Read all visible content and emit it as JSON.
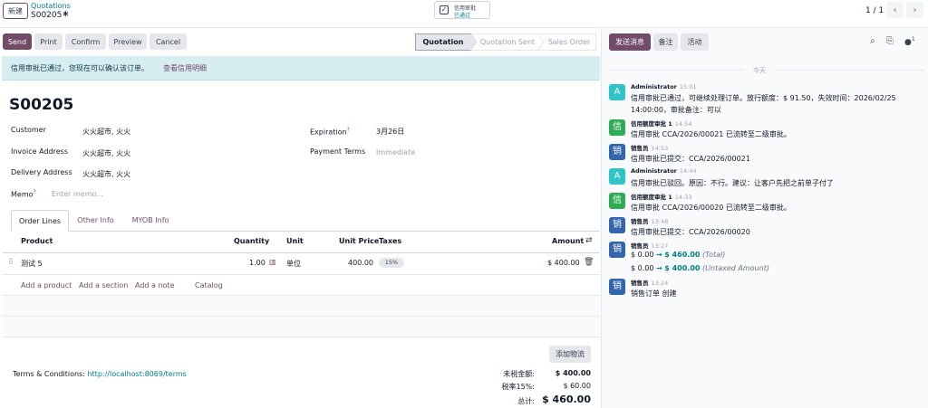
{
  "topbar": {
    "new_label": "新建",
    "breadcrumb_parent": "Quotations",
    "breadcrumb_current": "S00205",
    "credit_label": "信用审批",
    "credit_status": "已通过",
    "pager": "1 / 1"
  },
  "actions": {
    "send": "Send",
    "print": "Print",
    "confirm": "Confirm",
    "preview": "Preview",
    "cancel": "Cancel"
  },
  "stages": [
    "Quotation",
    "Quotation Sent",
    "Sales Order"
  ],
  "alert": {
    "text": "信用审批已通过，您现在可以确认该订单。",
    "link": "查看信用明细"
  },
  "form": {
    "name": "S00205",
    "customer_label": "Customer",
    "customer": "火火超市, 火火",
    "invoice_label": "Invoice Address",
    "invoice": "火火超市, 火火",
    "delivery_label": "Delivery Address",
    "delivery": "火火超市, 火火",
    "memo_label": "Memo",
    "memo_placeholder": "Enter memo...",
    "expiration_label": "Expiration",
    "expiration": "3月26日",
    "payment_label": "Payment Terms",
    "payment_placeholder": "Immediate",
    "help_mark": "?"
  },
  "tabs": [
    "Order Lines",
    "Other Info",
    "MYOB Info"
  ],
  "table": {
    "headers": {
      "product": "Product",
      "quantity": "Quantity",
      "unit": "Unit",
      "price": "Unit Price",
      "taxes": "Taxes",
      "amount": "Amount"
    },
    "rows": [
      {
        "product": "测试 5",
        "quantity": "1.00",
        "unit": "单位",
        "price": "400.00",
        "tax": "15%",
        "amount": "$ 400.00"
      }
    ],
    "add_product": "Add a product",
    "add_section": "Add a section",
    "add_note": "Add a note",
    "catalog": "Catalog"
  },
  "footer": {
    "add_logistics": "添加物流",
    "terms_label": "Terms & Conditions:",
    "terms_link": "http://localhost:8069/terms",
    "untaxed_label": "未税金额:",
    "untaxed": "$ 400.00",
    "tax_label": "税率15%:",
    "tax": "$ 60.00",
    "total_label": "总计:",
    "total": "$ 460.00"
  },
  "chatter": {
    "send_message": "发送消息",
    "log_note": "备注",
    "activity": "活动",
    "followers_count": "1",
    "today": "今天",
    "messages": [
      {
        "avatar": "A",
        "author": "Administrator",
        "time": "15:01",
        "line1": "信用审批已通过，可继续处理订单。放行额度：$ 91.50，失效时间：2026/02/25",
        "line2": "14:00:00，审批备注：可以"
      },
      {
        "avatar": "信",
        "author": "信用额度审批 1",
        "time": "14:54",
        "line1": "信用审批 CCA/2026/00021 已流转至二级审批。"
      },
      {
        "avatar": "销",
        "author": "销售员",
        "time": "14:53",
        "line1": "信用审批已提交：CCA/2026/00021"
      },
      {
        "avatar": "A",
        "author": "Administrator",
        "time": "14:44",
        "line1": "信用审批已驳回。原因：不行。建议：让客户先把之前单子付了"
      },
      {
        "avatar": "信",
        "author": "信用额度审批 1",
        "time": "14:33",
        "line1": "信用审批 CCA/2026/00020 已流转至二级审批。"
      },
      {
        "avatar": "销",
        "author": "销售员",
        "time": "13:48",
        "line1": "信用审批已提交：CCA/2026/00020"
      },
      {
        "avatar": "销",
        "author": "销售员",
        "time": "13:27",
        "tracking": [
          {
            "old": "$ 0.00",
            "new": "$ 460.00",
            "field": "(Total)"
          },
          {
            "old": "$ 0.00",
            "new": "$ 400.00",
            "field": "(Untaxed Amount)"
          }
        ]
      },
      {
        "avatar": "销",
        "author": "销售员",
        "time": "13:24",
        "line1": "销售订单 创建"
      }
    ],
    "arrow": "→"
  },
  "colors": {
    "primary": "#714b67",
    "teal": "#017e84",
    "alert_bg": "#d6eef2",
    "avatar_admin": "#2ec4c8",
    "avatar_credit": "#2eab55",
    "avatar_sales": "#3366aa"
  }
}
